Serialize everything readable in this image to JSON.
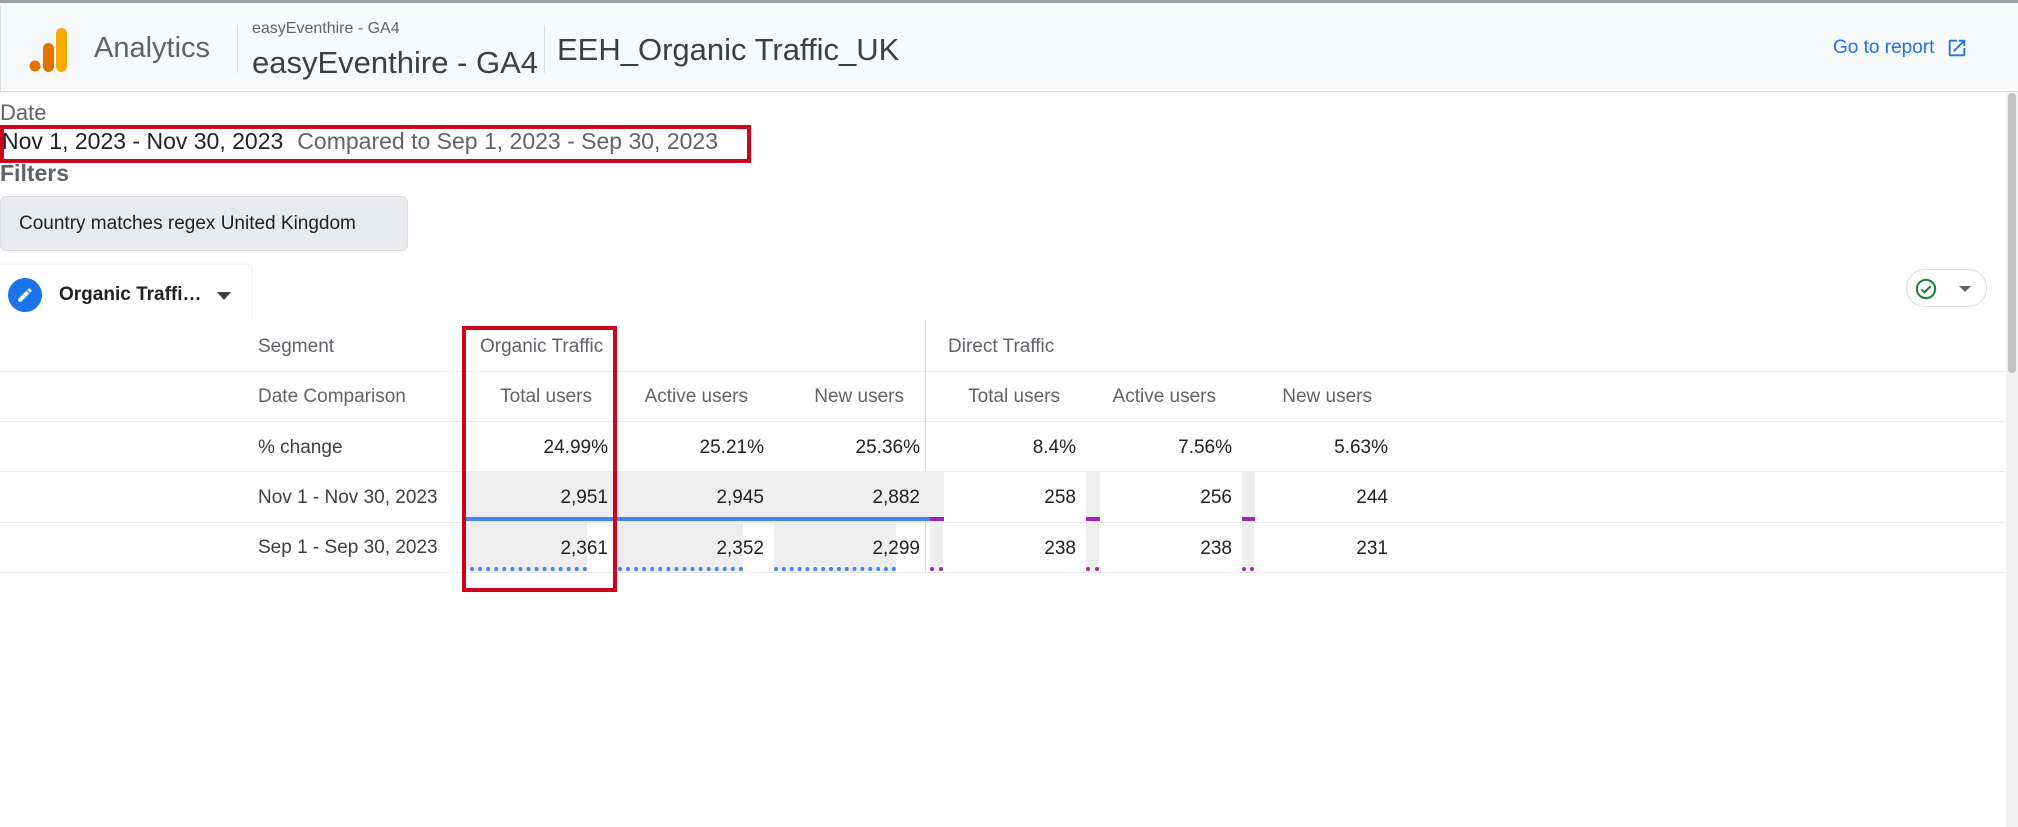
{
  "header": {
    "app_name": "Analytics",
    "account_name": "easyEventhire - GA4",
    "property_name": "easyEventhire - GA4",
    "report_name": "EEH_Organic Traffic_UK",
    "go_to_report": "Go to report",
    "logo_icon": "google-analytics-logo",
    "external_icon": "open-in-new-icon",
    "link_color": "#1a73e8"
  },
  "date": {
    "label": "Date",
    "range": "Nov 1, 2023 - Nov 30, 2023",
    "compare": "Compared to Sep 1, 2023 - Sep 30, 2023"
  },
  "filters": {
    "label": "Filters",
    "chip": "Country matches regex United Kingdom"
  },
  "tab": {
    "label": "Organic Traffi…",
    "icon": "pencil-icon",
    "status_icon": "check-circle-icon"
  },
  "table": {
    "segment_label": "Segment",
    "date_comparison_label": "Date Comparison",
    "segments": [
      "Organic Traffic",
      "Direct Traffic"
    ],
    "metrics": [
      "Total users",
      "Active users",
      "New users",
      "Total users",
      "Active users",
      "New users"
    ],
    "rows": [
      {
        "label": "% change",
        "values": [
          "24.99%",
          "25.21%",
          "25.36%",
          "8.4%",
          "7.56%",
          "5.63%"
        ]
      },
      {
        "label": "Nov 1 - Nov 30, 2023",
        "values": [
          "2,951",
          "2,945",
          "2,882",
          "258",
          "256",
          "244"
        ]
      },
      {
        "label": "Sep 1 - Sep 30, 2023",
        "values": [
          "2,361",
          "2,352",
          "2,299",
          "238",
          "238",
          "231"
        ]
      }
    ],
    "bar_fill": {
      "current": [
        1.0,
        1.0,
        1.0,
        0.087,
        0.087,
        0.083
      ],
      "previous": [
        0.8,
        0.8,
        0.78,
        0.081,
        0.081,
        0.078
      ]
    },
    "colors": {
      "organic": "#4285f4",
      "direct": "#9c27b0",
      "highlight": "#d0021b"
    }
  }
}
